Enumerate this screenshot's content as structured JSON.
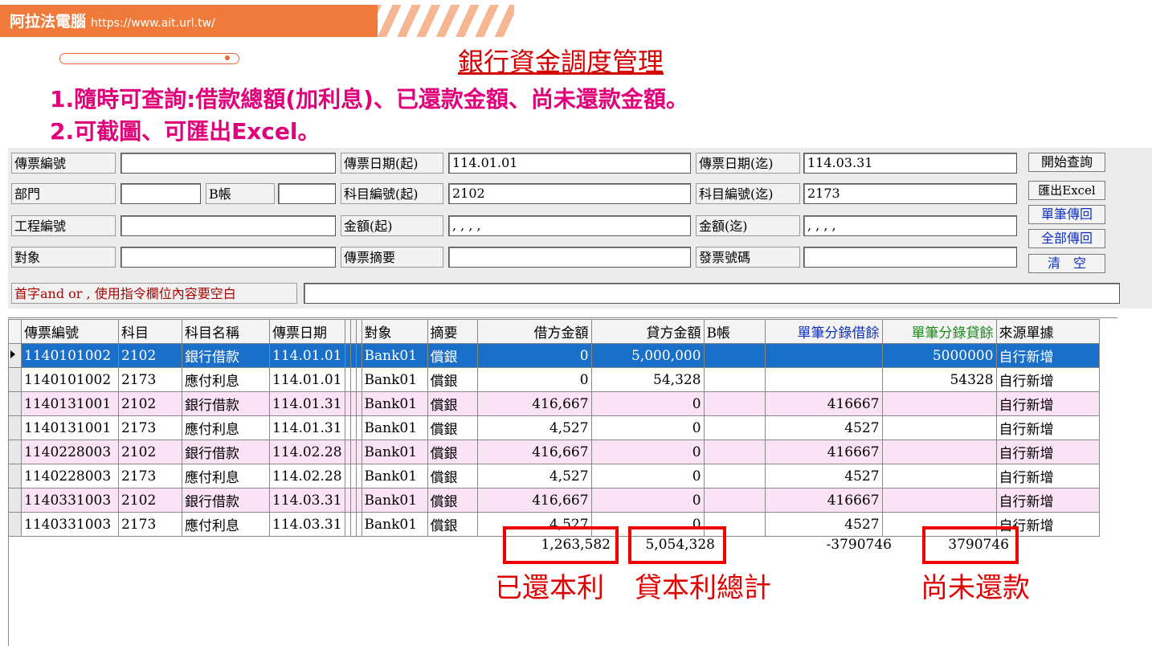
{
  "banner": {
    "brand": "阿拉法電腦",
    "url": "https://www.ait.url.tw/"
  },
  "title": "銀行資金調度管理",
  "bullets": [
    "1.隨時可查詢:借款總額(加利息)、已還款金額、尚未還款金額。",
    "2.可截圖、可匯出Excel。"
  ],
  "form": {
    "voucher_no_label": "傳票編號",
    "voucher_no": "",
    "date_from_label": "傳票日期(起)",
    "date_from": "114.01.01",
    "date_to_label": "傳票日期(迄)",
    "date_to": "114.03.31",
    "dept_label": "部門",
    "dept": "",
    "b_account_label": "B帳",
    "b_account": "",
    "acct_from_label": "科目編號(起)",
    "acct_from": "2102",
    "acct_to_label": "科目編號(迄)",
    "acct_to": "2173",
    "project_label": "工程編號",
    "project": "",
    "amount_from_label": "金額(起)",
    "amount_from": ", , , ,",
    "amount_to_label": "金額(迄)",
    "amount_to": ", , , ,",
    "party_label": "對象",
    "party": "",
    "summary_label": "傳票摘要",
    "summary": "",
    "invoice_label": "發票號碼",
    "invoice": "",
    "hint_label": "首字and or , 使用指令欄位內容要空白",
    "hint_value": ""
  },
  "buttons": {
    "start_query": "開始查詢",
    "export_excel": "匯出Excel",
    "single_return": "單筆傳回",
    "all_return": "全部傳回",
    "clear": "清　空"
  },
  "grid": {
    "headers": [
      "傳票編號",
      "科目",
      "科目名稱",
      "傳票日期",
      "對象",
      "摘要",
      "借方金額",
      "貸方金額",
      "B帳",
      "單筆分錄借餘",
      "單筆分錄貸餘",
      "來源單據"
    ],
    "rows": [
      [
        "1140101002",
        "2102",
        "銀行借款",
        "114.01.01",
        "Bank01",
        "償銀",
        "0",
        "5,000,000",
        "",
        "",
        "5000000",
        "自行新增"
      ],
      [
        "1140101002",
        "2173",
        "應付利息",
        "114.01.01",
        "Bank01",
        "償銀",
        "0",
        "54,328",
        "",
        "",
        "54328",
        "自行新增"
      ],
      [
        "1140131001",
        "2102",
        "銀行借款",
        "114.01.31",
        "Bank01",
        "償銀",
        "416,667",
        "0",
        "",
        "416667",
        "",
        "自行新增"
      ],
      [
        "1140131001",
        "2173",
        "應付利息",
        "114.01.31",
        "Bank01",
        "償銀",
        "4,527",
        "0",
        "",
        "4527",
        "",
        "自行新增"
      ],
      [
        "1140228003",
        "2102",
        "銀行借款",
        "114.02.28",
        "Bank01",
        "償銀",
        "416,667",
        "0",
        "",
        "416667",
        "",
        "自行新增"
      ],
      [
        "1140228003",
        "2173",
        "應付利息",
        "114.02.28",
        "Bank01",
        "償銀",
        "4,527",
        "0",
        "",
        "4527",
        "",
        "自行新增"
      ],
      [
        "1140331003",
        "2102",
        "銀行借款",
        "114.03.31",
        "Bank01",
        "償銀",
        "416,667",
        "0",
        "",
        "416667",
        "",
        "自行新增"
      ],
      [
        "1140331003",
        "2173",
        "應付利息",
        "114.03.31",
        "Bank01",
        "償銀",
        "4,527",
        "0",
        "",
        "4527",
        "",
        "自行新增"
      ]
    ],
    "totals": {
      "debit": "1,263,582",
      "credit": "5,054,328",
      "debit_balance": "-3790746",
      "credit_balance": "3790746"
    }
  },
  "annotations": {
    "repaid": "已還本利",
    "loan_total": "貸本利總計",
    "outstanding": "尚未還款"
  },
  "colors": {
    "accent_orange": "#f07a3a",
    "title_red": "#d40000",
    "bullet_magenta": "#e0007a",
    "selected_row": "#1a6fc9",
    "alt_row_pink": "#fbe3f7",
    "annotation_red": "#e00000"
  }
}
